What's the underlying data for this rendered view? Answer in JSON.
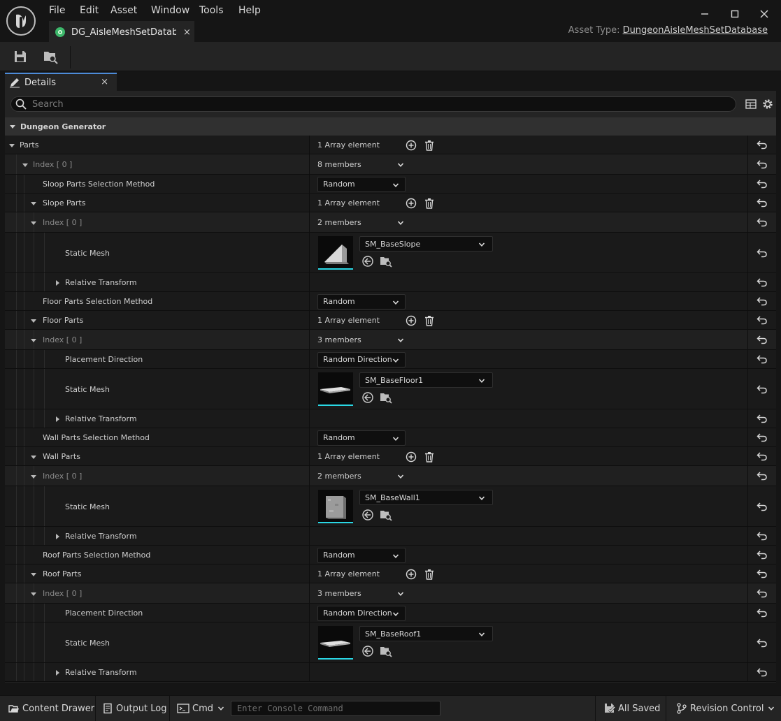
{
  "menu": [
    "File",
    "Edit",
    "Asset",
    "Window",
    "Tools",
    "Help"
  ],
  "document_tab": {
    "label": "DG_AisleMeshSetDatab...",
    "close": "×"
  },
  "asset_type": {
    "label": "Asset Type:",
    "value": "DungeonAisleMeshSetDatabase"
  },
  "details_tab": {
    "label": "Details",
    "close": "×"
  },
  "search": {
    "placeholder": "Search"
  },
  "category": "Dungeon Generator",
  "rows": [
    {
      "label": "Parts",
      "value": "1 Array element"
    },
    {
      "label": "Index [ 0 ]",
      "value": "8 members"
    },
    {
      "label": "Sloop Parts Selection Method",
      "value": "Random"
    },
    {
      "label": "Slope Parts",
      "value": "1 Array element"
    },
    {
      "label": "Index [ 0 ]",
      "value": "2 members"
    },
    {
      "label": "Static Mesh",
      "value": "SM_BaseSlope"
    },
    {
      "label": "Relative Transform",
      "value": ""
    },
    {
      "label": "Floor Parts Selection Method",
      "value": "Random"
    },
    {
      "label": "Floor Parts",
      "value": "1 Array element"
    },
    {
      "label": "Index [ 0 ]",
      "value": "3 members"
    },
    {
      "label": "Placement Direction",
      "value": "Random Direction"
    },
    {
      "label": "Static Mesh",
      "value": "SM_BaseFloor1"
    },
    {
      "label": "Relative Transform",
      "value": ""
    },
    {
      "label": "Wall Parts Selection Method",
      "value": "Random"
    },
    {
      "label": "Wall Parts",
      "value": "1 Array element"
    },
    {
      "label": "Index [ 0 ]",
      "value": "2 members"
    },
    {
      "label": "Static Mesh",
      "value": "SM_BaseWall1"
    },
    {
      "label": "Relative Transform",
      "value": ""
    },
    {
      "label": "Roof Parts Selection Method",
      "value": "Random"
    },
    {
      "label": "Roof Parts",
      "value": "1 Array element"
    },
    {
      "label": "Index [ 0 ]",
      "value": "3 members"
    },
    {
      "label": "Placement Direction",
      "value": "Random Direction"
    },
    {
      "label": "Static Mesh",
      "value": "SM_BaseRoof1"
    },
    {
      "label": "Relative Transform",
      "value": ""
    }
  ],
  "statusbar": {
    "content_drawer": "Content Drawer",
    "output_log": "Output Log",
    "cmd": "Cmd",
    "console_placeholder": "Enter Console Command",
    "saved": "All Saved",
    "revision_control": "Revision Control"
  },
  "colors": {
    "accent_blue": "#4d8bd8",
    "thumb_underline": "#2ad7e4",
    "tab_icon_green": "#3db86b",
    "panel_bg": "#242424",
    "row_bg": "#1a1a1a"
  }
}
